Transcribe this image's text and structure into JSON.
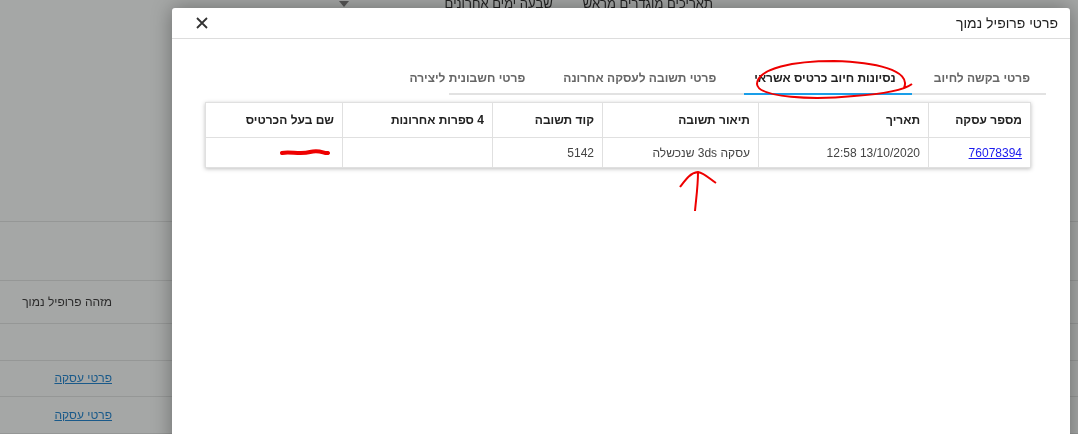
{
  "background": {
    "filters": [
      {
        "label": "תאריכים מוגדרים מראש",
        "kind": "text"
      },
      {
        "label": "שבעה ימים אחרונים",
        "kind": "dropdown"
      }
    ],
    "rows": [
      {
        "kind": "empty"
      },
      {
        "kind": "text",
        "text": "מזהה פרופיל נמוך"
      },
      {
        "kind": "empty"
      },
      {
        "kind": "link",
        "text": "פרטי עסקה"
      },
      {
        "kind": "link",
        "text": "פרטי עסקה"
      }
    ]
  },
  "dialog": {
    "title": "פרטי פרופיל נמוך",
    "tabs": [
      {
        "label": "פרטי בקשה לחיוב",
        "selected": false
      },
      {
        "label": "נסיונות חיוב כרטיס אשראי",
        "selected": true
      },
      {
        "label": "פרטי תשובה לעסקה אחרונה",
        "selected": false
      },
      {
        "label": "פרטי חשבונית ליצירה",
        "selected": false
      }
    ],
    "table": {
      "columns": [
        "מספר עסקה",
        "תאריך",
        "תיאור תשובה",
        "קוד תשובה",
        "4 ספרות אחרונות",
        "שם בעל הכרטיס"
      ],
      "rows": [
        {
          "cells": [
            {
              "kind": "link",
              "text": "76078394"
            },
            {
              "kind": "text",
              "text": "12:58 13/10/2020"
            },
            {
              "kind": "text",
              "text": "עסקה 3ds שנכשלה"
            },
            {
              "kind": "text",
              "text": "5142"
            },
            {
              "kind": "empty"
            },
            {
              "kind": "redacted"
            }
          ]
        }
      ]
    },
    "annotations": [
      {
        "kind": "ellipse"
      },
      {
        "kind": "arrow"
      }
    ]
  }
}
